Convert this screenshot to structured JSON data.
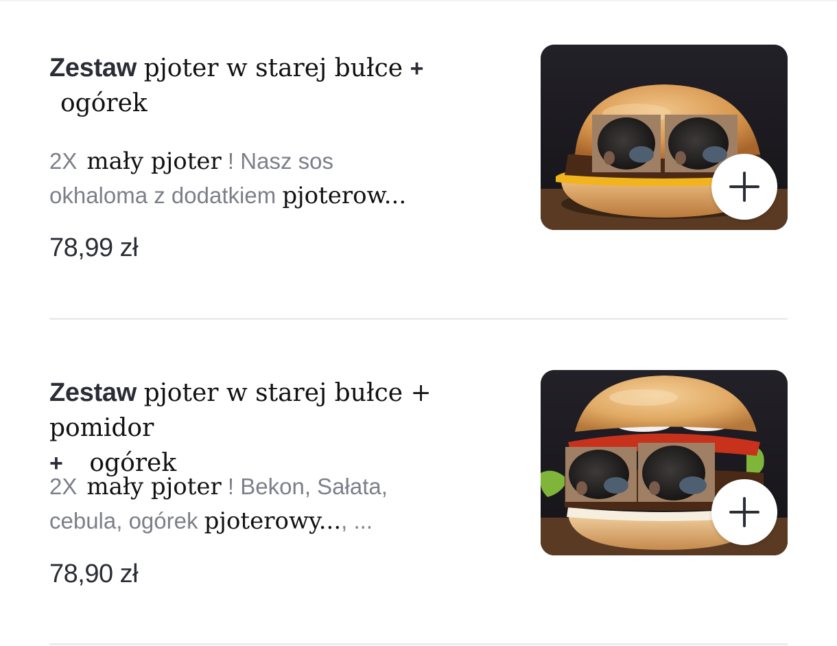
{
  "menu": {
    "items": [
      {
        "title_prefix": "Zestaw",
        "title_name": "pjoter w starej bułce",
        "title_plus": "+",
        "title_line2": "ogórek",
        "desc_qty": "2X",
        "desc_item": "mały pjoter",
        "desc_rest": "! Nasz sos",
        "desc_line2_a": "okhaloma z dodatkiem",
        "desc_line2_b": "pjoterow...",
        "price": "78,99 zł",
        "add_icon": "plus-icon",
        "image_icon": "burger-photo"
      },
      {
        "title_prefix": "Zestaw",
        "title_name": "pjoter w starej bułce + pomidor",
        "title_plus": "+",
        "title_line2": "ogórek",
        "desc_qty": "2X",
        "desc_item": "mały pjoter",
        "desc_rest": "! Bekon, Sałata,",
        "desc_line2_a": "cebula, ogórek",
        "desc_line2_b": "pjoterowy...",
        "desc_line2_c": ", ...",
        "price": "78,90 zł",
        "add_icon": "plus-icon",
        "image_icon": "burger-photo"
      }
    ]
  },
  "colors": {
    "text_primary": "#2a2d36",
    "text_secondary": "#7b7f89",
    "divider": "#ececee",
    "background": "#ffffff"
  }
}
